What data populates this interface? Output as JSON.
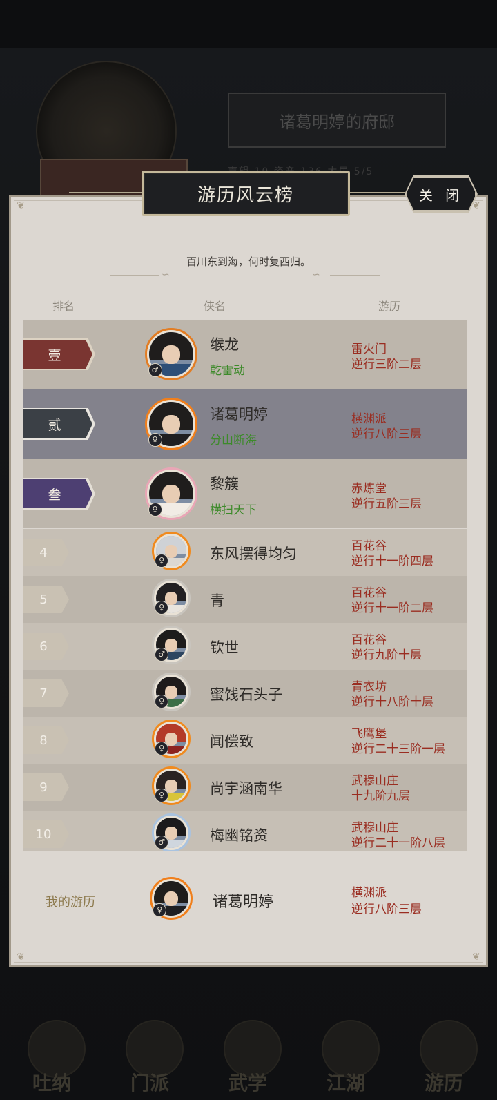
{
  "background": {
    "residence_title": "诸葛明婷的府邸",
    "stats_text": "声望 10  资产 136  木居 5/5",
    "nav": [
      "吐纳",
      "门派",
      "武学",
      "江湖",
      "游历"
    ]
  },
  "panel": {
    "title": "游历风云榜",
    "close_label": "关 闭",
    "subtitle": "百川东到海，何时复西归。",
    "columns": {
      "rank": "排名",
      "name": "侠名",
      "travel": "游历"
    }
  },
  "top_rows": [
    {
      "rank": "壹",
      "name": "缑龙",
      "title": "乾雷动",
      "sect": "雷火门",
      "level": "逆行三阶二层",
      "gender": "male",
      "row_color": "#bdb6ac",
      "flag_color": "#7a3531",
      "flag_border": "#dcd2c2",
      "robe_color": "#2e4f77",
      "ring": "#e27d24"
    },
    {
      "rank": "贰",
      "name": "诸葛明婷",
      "title": "分山断海",
      "sect": "横渊派",
      "level": "逆行八阶三层",
      "gender": "female",
      "row_color": "#83828c",
      "flag_color": "#3b4046",
      "flag_border": "#e8e5df",
      "robe_color": "#1f1f22",
      "ring": "#f07f1c"
    },
    {
      "rank": "叁",
      "name": "黎簇",
      "title": "横扫天下",
      "sect": "赤炼堂",
      "level": "逆行五阶三层",
      "gender": "female",
      "row_color": "#bdb6ac",
      "flag_color": "#4d3f72",
      "flag_border": "#e4dfd6",
      "robe_color": "#f1ece5",
      "ring": "#e9a6b6"
    }
  ],
  "rows": [
    {
      "rank": "4",
      "name": "东风摆得均匀",
      "sect": "百花谷",
      "level": "逆行十一阶四层",
      "gender": "female",
      "row_color": "#c6bfb5",
      "robe_color": "#dcd8d2",
      "ring": "#f08a1e",
      "hair": "#cfd2d6"
    },
    {
      "rank": "5",
      "name": "青",
      "sect": "百花谷",
      "level": "逆行十一阶二层",
      "gender": "female",
      "row_color": "#bcb5ab",
      "robe_color": "#e8e4de",
      "ring": "#c9c5be",
      "hair": "#222022"
    },
    {
      "rank": "6",
      "name": "钦世",
      "sect": "百花谷",
      "level": "逆行九阶十层",
      "gender": "male",
      "row_color": "#c6bfb5",
      "robe_color": "#2d4560",
      "ring": "#c9c5be",
      "hair": "#1d1c1c"
    },
    {
      "rank": "7",
      "name": "蜜饯石头子",
      "sect": "青衣坊",
      "level": "逆行十八阶十层",
      "gender": "female",
      "row_color": "#bcb5ab",
      "robe_color": "#3c6e46",
      "ring": "#c9c5be",
      "hair": "#1e1b1b"
    },
    {
      "rank": "8",
      "name": "闻偿致",
      "sect": "飞鹰堡",
      "level": "逆行二十三阶一层",
      "gender": "female",
      "row_color": "#c6bfb5",
      "robe_color": "#8d2320",
      "ring": "#f08a1e",
      "hair": "#b33a28"
    },
    {
      "rank": "9",
      "name": "尚宇涵南华",
      "sect": "武穆山庄",
      "level": "十九阶九层",
      "gender": "female",
      "row_color": "#bcb5ab",
      "robe_color": "#d9c43a",
      "ring": "#f08a1e",
      "hair": "#2b2321"
    },
    {
      "rank": "10",
      "name": "梅幽铭资",
      "sect": "武穆山庄",
      "level": "逆行二十一阶八层",
      "gender": "male",
      "row_color": "#c6bfb5",
      "robe_color": "#cfd6de",
      "ring": "#a9c3e0",
      "hair": "#1b1a1c"
    }
  ],
  "mine": {
    "label": "我的游历",
    "name": "诸葛明婷",
    "sect": "横渊派",
    "level": "逆行八阶三层"
  }
}
